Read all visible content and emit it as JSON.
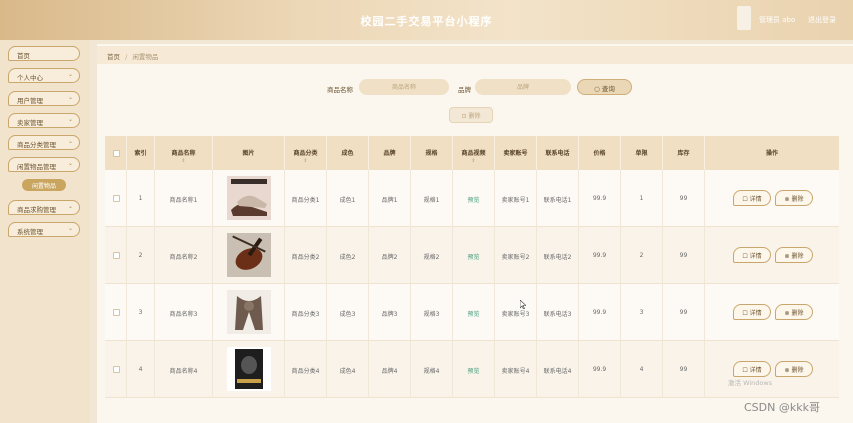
{
  "header": {
    "title": "校园二手交易平台小程序",
    "user_label": "管理员 abo",
    "logout_label": "退出登录"
  },
  "sidebar": {
    "items": [
      {
        "label": "首页",
        "chevron": ""
      },
      {
        "label": "个人中心",
        "chevron": "⌄"
      },
      {
        "label": "用户管理",
        "chevron": "⌄"
      },
      {
        "label": "卖家管理",
        "chevron": "⌄"
      },
      {
        "label": "商品分类管理",
        "chevron": "⌄"
      },
      {
        "label": "闲置物品管理",
        "chevron": "⌄"
      },
      {
        "label": "商品求购管理",
        "chevron": "⌄"
      },
      {
        "label": "系统管理",
        "chevron": "⌄"
      }
    ],
    "active_sub": "闲置物品"
  },
  "breadcrumb": {
    "home": "首页",
    "separator": "/",
    "current": "闲置物品"
  },
  "search": {
    "name_label": "商品名称",
    "name_placeholder": "商品名称",
    "brand_label": "品牌",
    "brand_placeholder": "品牌",
    "query_label": "查询",
    "bulk_delete_label": "删除"
  },
  "table": {
    "columns": [
      "索引",
      "商品名称",
      "图片",
      "商品分类",
      "成色",
      "品牌",
      "规格",
      "商品视频",
      "卖家账号",
      "联系电话",
      "价格",
      "单限",
      "库存",
      "操作"
    ],
    "sort_glyph": "⇕",
    "rows": [
      {
        "index": "1",
        "name": "商品名称1",
        "image": "shoes",
        "category": "商品分类1",
        "condition": "成色1",
        "brand": "品牌1",
        "spec": "规格1",
        "video": "预览",
        "seller": "卖家账号1",
        "phone": "联系电话1",
        "price": "99.9",
        "limit": "1",
        "stock": "99"
      },
      {
        "index": "2",
        "name": "商品名称2",
        "image": "violin",
        "category": "商品分类2",
        "condition": "成色2",
        "brand": "品牌2",
        "spec": "规格2",
        "video": "预览",
        "seller": "卖家账号2",
        "phone": "联系电话2",
        "price": "99.9",
        "limit": "2",
        "stock": "99"
      },
      {
        "index": "3",
        "name": "商品名称3",
        "image": "scarf",
        "category": "商品分类3",
        "condition": "成色3",
        "brand": "品牌3",
        "spec": "规格3",
        "video": "预览",
        "seller": "卖家账号3",
        "phone": "联系电话3",
        "price": "99.9",
        "limit": "3",
        "stock": "99"
      },
      {
        "index": "4",
        "name": "商品名称4",
        "image": "book",
        "category": "商品分类4",
        "condition": "成色4",
        "brand": "品牌4",
        "spec": "规格4",
        "video": "预览",
        "seller": "卖家账号4",
        "phone": "联系电话4",
        "price": "99.9",
        "limit": "4",
        "stock": "99"
      }
    ],
    "detail_label": "详情",
    "delete_label": "删除"
  },
  "watermark": {
    "text": "CSDN @kkk哥",
    "activate_text": "激活 Windows"
  },
  "colors": {
    "accent": "#c9a66b",
    "header_bg": "#e9d2ae",
    "preview_link": "#3f9a78"
  }
}
